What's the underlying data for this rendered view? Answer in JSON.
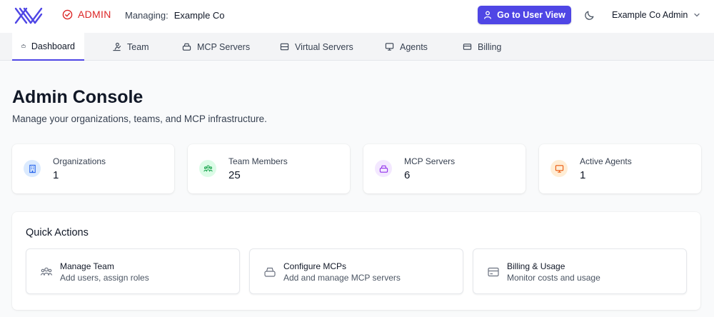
{
  "header": {
    "admin_label": "ADMIN",
    "managing_label": "Managing:",
    "org_name": "Example Co",
    "user_view_button": "Go to User View",
    "account_name": "Example Co Admin"
  },
  "tabs": [
    {
      "label": "Dashboard",
      "icon": "briefcase-icon",
      "active": true
    },
    {
      "label": "Team",
      "icon": "team-icon",
      "active": false
    },
    {
      "label": "MCP Servers",
      "icon": "mcp-icon",
      "active": false
    },
    {
      "label": "Virtual Servers",
      "icon": "server-icon",
      "active": false
    },
    {
      "label": "Agents",
      "icon": "monitor-icon",
      "active": false
    },
    {
      "label": "Billing",
      "icon": "credit-card-icon",
      "active": false
    }
  ],
  "main": {
    "title": "Admin Console",
    "subtitle": "Manage your organizations, teams, and MCP infrastructure."
  },
  "stats": [
    {
      "label": "Organizations",
      "value": "1",
      "icon": "building-icon",
      "color": "#2563eb",
      "bg": "#dbeafe"
    },
    {
      "label": "Team Members",
      "value": "25",
      "icon": "users-icon",
      "color": "#16a34a",
      "bg": "#dcfce7"
    },
    {
      "label": "MCP Servers",
      "value": "6",
      "icon": "mcp-icon",
      "color": "#9333ea",
      "bg": "#f3e8ff"
    },
    {
      "label": "Active Agents",
      "value": "1",
      "icon": "monitor-icon",
      "color": "#ea580c",
      "bg": "#ffedd5"
    }
  ],
  "quick_actions": {
    "title": "Quick Actions",
    "items": [
      {
        "name": "Manage Team",
        "description": "Add users, assign roles",
        "icon": "users-icon"
      },
      {
        "name": "Configure MCPs",
        "description": "Add and manage MCP servers",
        "icon": "mcp-icon"
      },
      {
        "name": "Billing & Usage",
        "description": "Monitor costs and usage",
        "icon": "credit-card-icon"
      }
    ]
  },
  "colors": {
    "accent": "#4f46e5",
    "admin": "#dc2626"
  }
}
